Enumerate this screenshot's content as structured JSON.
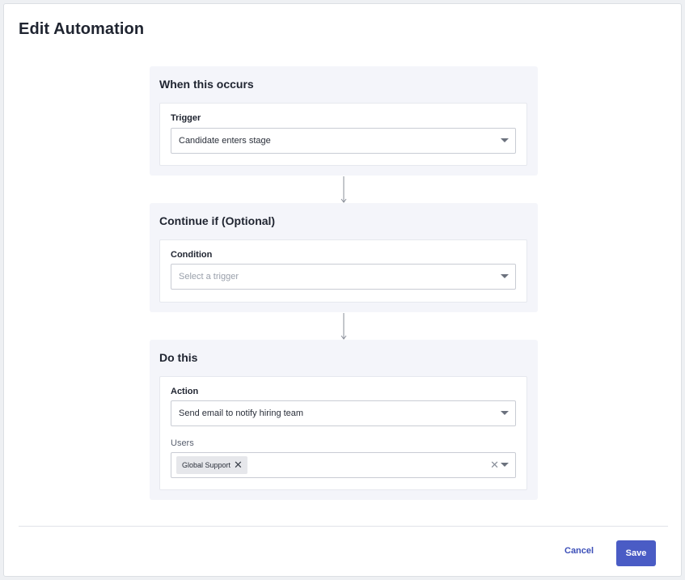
{
  "modal": {
    "title": "Edit Automation"
  },
  "sections": {
    "trigger": {
      "title": "When this occurs",
      "field_label": "Trigger",
      "value": "Candidate enters stage"
    },
    "condition": {
      "title": "Continue if (Optional)",
      "field_label": "Condition",
      "placeholder": "Select a trigger"
    },
    "action": {
      "title": "Do this",
      "field_label": "Action",
      "value": "Send email to notify hiring team",
      "users_label": "Users",
      "users_selected": [
        "Global Support"
      ]
    }
  },
  "footer": {
    "cancel_label": "Cancel",
    "save_label": "Save"
  },
  "colors": {
    "primary": "#4a5cc5",
    "link": "#3c4fb8",
    "section_bg": "#f4f5fa"
  },
  "icons": {
    "dropdown": "caret-down-icon",
    "remove_chip": "close-icon",
    "clear": "clear-icon",
    "connector": "arrow-down-icon"
  }
}
